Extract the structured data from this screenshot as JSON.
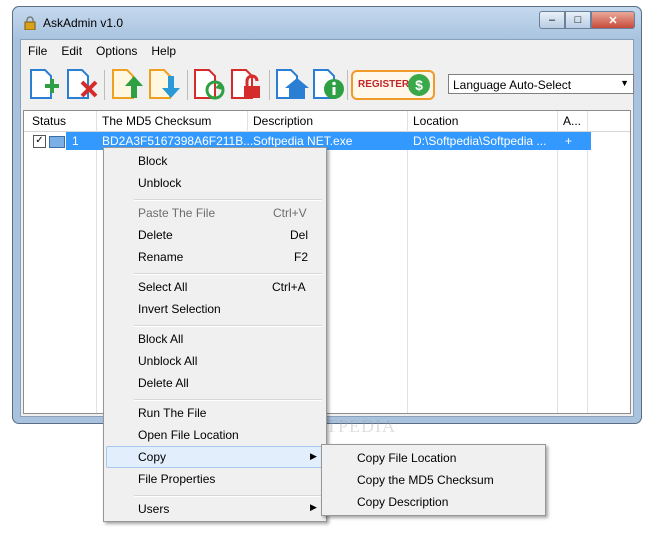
{
  "window": {
    "title": "AskAdmin v1.0"
  },
  "menubar": [
    "File",
    "Edit",
    "Options",
    "Help"
  ],
  "toolbar": {
    "buttons": [
      "add-file",
      "remove-file",
      "import",
      "export",
      "refresh",
      "unlock",
      "home",
      "info"
    ],
    "register_label": "REGISTER",
    "register_symbol": "$",
    "language": "Language Auto-Select"
  },
  "table": {
    "headers": [
      "Status",
      "The MD5 Checksum",
      "Description",
      "Location",
      "A..."
    ],
    "rows": [
      {
        "checked": true,
        "num": "1",
        "md5": "BD2A3F5167398A6F211B...",
        "description": "Softpedia NET.exe",
        "location": "D:\\Softpedia\\Softpedia ...",
        "a": "+"
      }
    ]
  },
  "context_menu": {
    "items": [
      {
        "label": "Block"
      },
      {
        "label": "Unblock"
      },
      {
        "label": "Paste The File",
        "shortcut": "Ctrl+V",
        "disabled": true
      },
      {
        "label": "Delete",
        "shortcut": "Del"
      },
      {
        "label": "Rename",
        "shortcut": "F2"
      },
      {
        "label": "Select All",
        "shortcut": "Ctrl+A"
      },
      {
        "label": "Invert Selection"
      },
      {
        "label": "Block All"
      },
      {
        "label": "Unblock All"
      },
      {
        "label": "Delete All"
      },
      {
        "label": "Run The File"
      },
      {
        "label": "Open File Location"
      },
      {
        "label": "Copy",
        "submenu": true,
        "highlighted": true
      },
      {
        "label": "File Properties"
      },
      {
        "label": "Users",
        "submenu": true
      }
    ]
  },
  "submenu": {
    "items": [
      "Copy File Location",
      "Copy the MD5 Checksum",
      "Copy Description"
    ]
  },
  "watermark": "SOFTPEDIA",
  "colors": {
    "selection": "#3399ff",
    "menu_bg": "#f0f0f0",
    "title_bar": "#a9c3de"
  }
}
